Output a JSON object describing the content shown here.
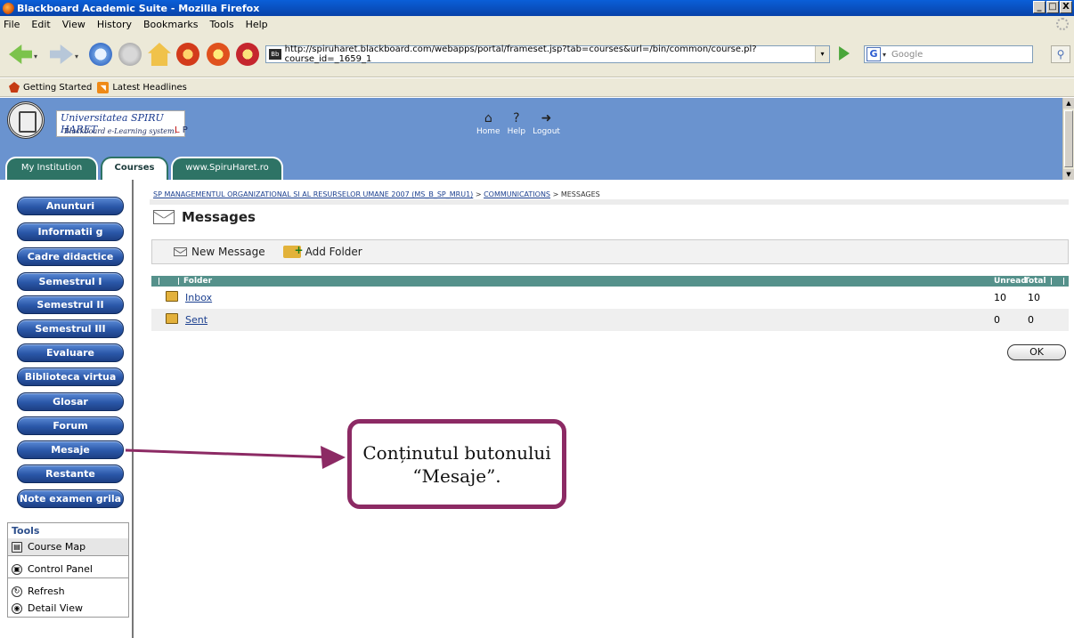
{
  "window": {
    "title": "Blackboard Academic Suite - Mozilla Firefox",
    "controls": [
      "_",
      "□",
      "X"
    ]
  },
  "menubar": [
    "File",
    "Edit",
    "View",
    "History",
    "Bookmarks",
    "Tools",
    "Help"
  ],
  "navbar": {
    "url": "http://spiruharet.blackboard.com/webapps/portal/frameset.jsp?tab=courses&url=/bin/common/course.pl?course_id=_1659_1",
    "search_placeholder": "Google"
  },
  "bookmarks": [
    "Getting Started",
    "Latest Headlines"
  ],
  "header": {
    "university": "Universitatea SPIRU HARET",
    "subtitle": "Blackboard e-Learning system.",
    "user_initials": "L",
    "user_initials2": "P",
    "topnav": [
      "Home",
      "Help",
      "Logout"
    ],
    "tabs": [
      "My Institution",
      "Courses",
      "www.SpiruHaret.ro"
    ]
  },
  "course_menu": [
    "Anunturi",
    "Informatii g",
    "Cadre didactice",
    "Semestrul I",
    "Semestrul II",
    "Semestrul III",
    "Evaluare",
    "Biblioteca virtua",
    "Glosar",
    "Forum",
    "Mesaje",
    "Restante",
    "Note examen grila"
  ],
  "tools": {
    "title": "Tools",
    "items": [
      "Course Map",
      "Control Panel",
      "Refresh",
      "Detail View"
    ]
  },
  "breadcrumb": {
    "course": "SP MANAGEMENTUL ORGANIZATIONAL SI AL RESURSELOR UMANE 2007 (MS_B_SP_MRU1)",
    "section": "COMMUNICATIONS",
    "current": "MESSAGES",
    "sep": ">"
  },
  "page_title": "Messages",
  "actions": {
    "new_message": "New Message",
    "add_folder": "Add Folder"
  },
  "table": {
    "headers": {
      "folder": "Folder",
      "unread": "Unread",
      "total": "Total"
    },
    "rows": [
      {
        "folder": "Inbox",
        "unread": "10",
        "total": "10"
      },
      {
        "folder": "Sent",
        "unread": "0",
        "total": "0"
      }
    ]
  },
  "ok_label": "OK",
  "callout": {
    "line1": "Conținutul butonului",
    "line2": "“Mesaje”."
  },
  "colors": {
    "header_blue": "#6a93cf",
    "tab_green": "#2e7365",
    "table_header": "#55918b",
    "callout_border": "#8c2a64"
  }
}
